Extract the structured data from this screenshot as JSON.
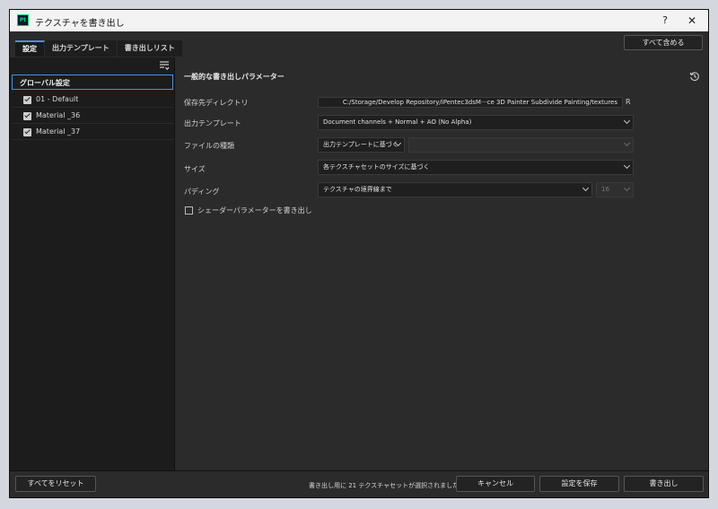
{
  "app": {
    "icon_text": "Pt",
    "title": "テクスチャを書き出し",
    "help": "?",
    "close": "✕"
  },
  "tabs": [
    {
      "label": "設定",
      "active": true
    },
    {
      "label": "出力テンプレート",
      "active": false
    },
    {
      "label": "書き出しリスト",
      "active": false
    }
  ],
  "header": {
    "include_all_label": "すべて含める"
  },
  "left": {
    "global_label": "グローバル設定",
    "materials": [
      {
        "label": "01 - Default",
        "checked": true
      },
      {
        "label": "Material _36",
        "checked": true
      },
      {
        "label": "Material _37",
        "checked": true
      }
    ],
    "icons": {
      "filter": "filter-list-icon"
    }
  },
  "params": {
    "section_title": "一般的な書き出しパラメーター",
    "save_dir_label": "保存先ディレクトリ",
    "save_dir_value": "C:/Storage/Develop Repository/iPentec3dsM···ce 3D Painter Subdivide Painting/textures",
    "save_dir_suffix": "R",
    "template_label": "出力テンプレート",
    "template_value": "Document channels + Normal + AO (No Alpha)",
    "file_type_label": "ファイルの種類",
    "file_type_value": "出力テンプレートに基づく",
    "file_type_secondary": "",
    "size_label": "サイズ",
    "size_value": "各テクスチャセットのサイズに基づく",
    "padding_label": "パディング",
    "padding_value": "テクスチャの境界線まで",
    "padding_amount": "16",
    "shader_label": "シェーダーパラメーターを書き出し",
    "shader_checked": false,
    "icons": {
      "reset": "reset-icon"
    }
  },
  "footer": {
    "reset_all_label": "すべてをリセット",
    "status_text": "書き出し用に 21 テクスチャセットが選択されました",
    "cancel_label": "キャンセル",
    "save_settings_label": "設定を保存",
    "export_label": "書き出し"
  },
  "colors": {
    "accent": "#4a90e2",
    "background": "#2b2b2b",
    "panel": "#1c1c1c"
  }
}
